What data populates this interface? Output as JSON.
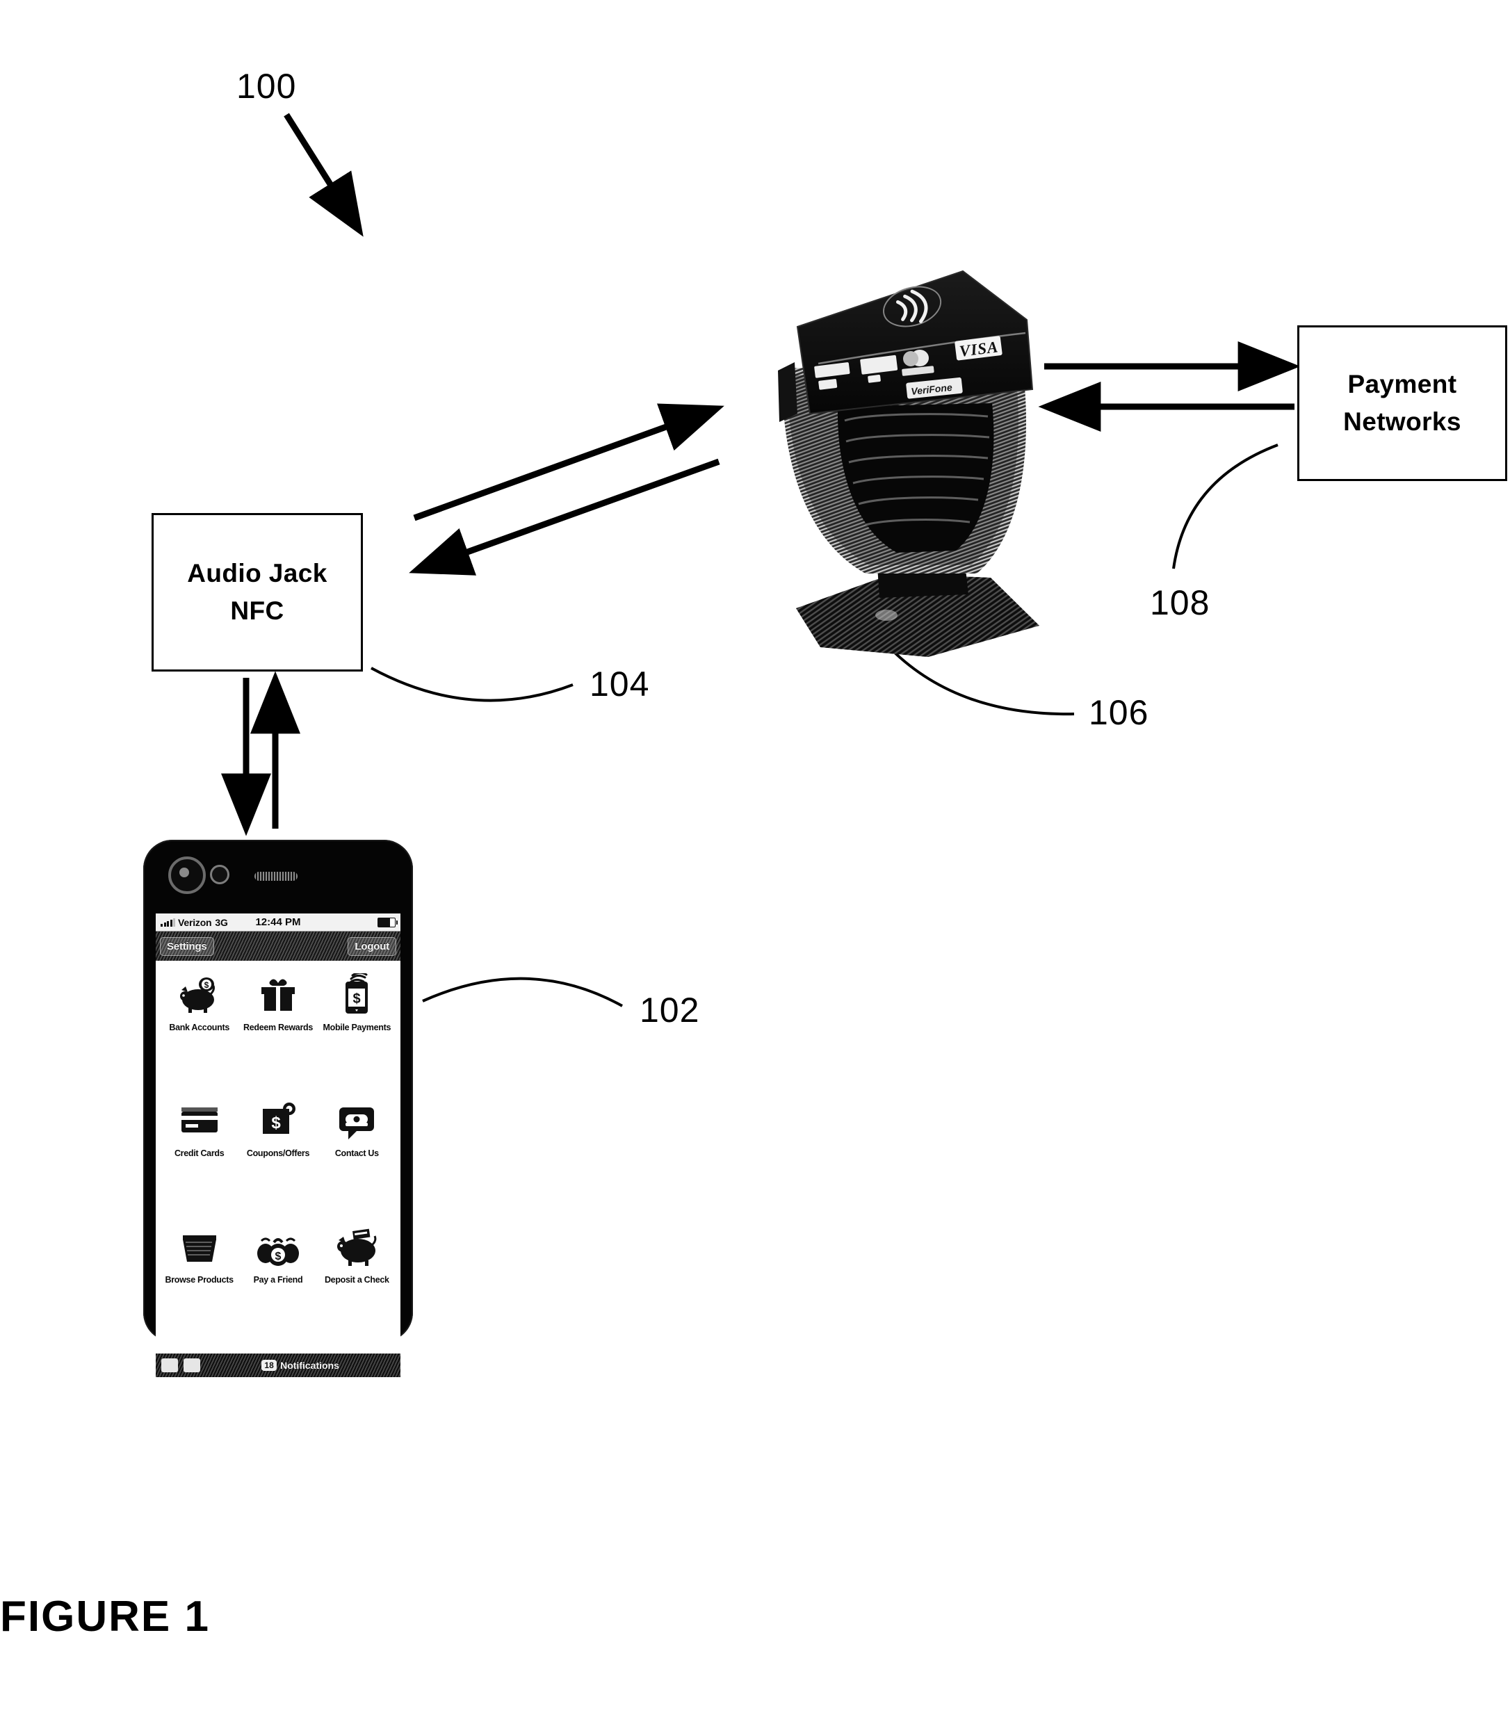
{
  "figure": {
    "caption": "FIGURE 1",
    "system_ref": "100"
  },
  "nodes": {
    "audio_jack": {
      "ref": "104",
      "line1": "Audio Jack",
      "line2": "NFC"
    },
    "payment_networks": {
      "ref": "108",
      "line1": "Payment",
      "line2": "Networks"
    },
    "mobile_device": {
      "ref": "102"
    },
    "pos_terminal": {
      "ref": "106",
      "brand": "VeriFone",
      "nfc_symbol": "contactless-wave-icon",
      "card_logos": [
        "maestro-logo",
        "mastercard-logo",
        "paypass-logo",
        "VISA"
      ]
    }
  },
  "phone": {
    "status_bar": {
      "carrier": "Verizon",
      "network": "3G",
      "time": "12:44 PM",
      "signal_icon": "signal-bars-icon",
      "battery_icon": "battery-icon"
    },
    "nav_bar": {
      "left_button": "Settings",
      "right_button": "Logout"
    },
    "apps": [
      {
        "label": "Bank Accounts",
        "icon": "piggy-bank-icon"
      },
      {
        "label": "Redeem Rewards",
        "icon": "gift-box-icon"
      },
      {
        "label": "Mobile Payments",
        "icon": "phone-nfc-dollar-icon"
      },
      {
        "label": "Credit Cards",
        "icon": "credit-card-icon"
      },
      {
        "label": "Coupons/Offers",
        "icon": "money-tag-icon"
      },
      {
        "label": "Contact Us",
        "icon": "telephone-bubble-icon"
      },
      {
        "label": "Browse Products",
        "icon": "shopping-basket-icon"
      },
      {
        "label": "Pay a Friend",
        "icon": "money-bags-icon"
      },
      {
        "label": "Deposit a Check",
        "icon": "piggy-bank-check-icon"
      }
    ],
    "toolbar": {
      "notification_count": "18",
      "notification_label": "Notifications"
    }
  },
  "colors": {
    "ink": "#000000",
    "paper": "#ffffff"
  }
}
